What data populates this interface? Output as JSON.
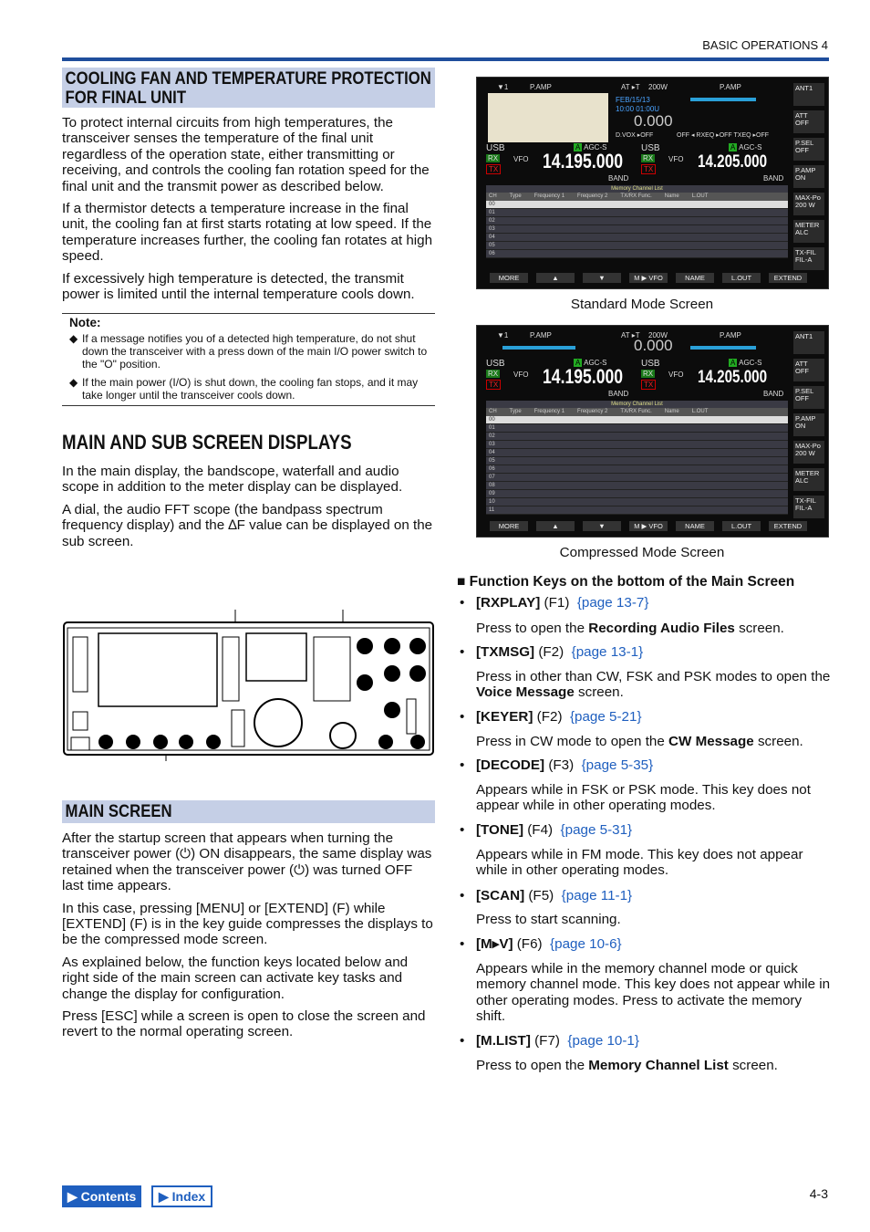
{
  "header": {
    "section": "BASIC OPERATIONS 4",
    "page": "4-3"
  },
  "cooling": {
    "title": "COOLING FAN AND TEMPERATURE PROTECTION FOR FINAL UNIT",
    "p1": "To protect internal circuits from high temperatures, the transceiver senses the temperature of the final unit regardless of the operation state, either transmitting or receiving, and controls the cooling fan rotation speed for the final unit and the transmit power as described below.",
    "p2": "If a thermistor detects a temperature increase in the final unit, the cooling fan at first starts rotating at low speed. If the temperature increases further, the cooling fan rotates at high speed.",
    "p3": "If excessively high temperature is detected, the transmit power is limited until the internal temperature cools down.",
    "note_title": "Note:",
    "note1": "If a message notifies you of a detected high temperature, do not shut down the transceiver with a press down of the main I/O power switch to the \"O\" position.",
    "note2": "If the main power (I/O) is shut down, the cooling fan stops, and it may take longer until the transceiver cools down."
  },
  "displays": {
    "title": "MAIN AND SUB SCREEN DISPLAYS",
    "p1": "In the main display, the bandscope, waterfall and audio scope in addition to the meter display can be displayed.",
    "p2": "A dial, the audio FFT scope (the bandpass spectrum frequency display) and the ∆F value can be displayed on the sub screen."
  },
  "main_screen": {
    "title": "MAIN SCREEN",
    "p1": "After the startup screen that appears when turning the transceiver power (⏻) ON disappears, the same display was retained when the transceiver power (⏻) was turned OFF last time appears.",
    "p2": "In this case, pressing [MENU] or [EXTEND] (F) while [EXTEND] (F) is in the key guide compresses the displays to be the compressed mode screen.",
    "p3": "As explained below, the function keys located below and right side of the main screen can activate key tasks and change the display for configuration.",
    "p4": "Press [ESC] while a screen is open to close the screen and revert to the normal operating screen."
  },
  "screen": {
    "pamp": "P.AMP",
    "at": "AT ▸T",
    "power": "200W",
    "date": "FEB/15/13",
    "time": "10:00 01:00U",
    "delta": "0.000",
    "dvox": "D.VOX ▸OFF",
    "eq": "OFF ◂ RXEQ ▸OFF  TXEQ ▸OFF",
    "mode": "USB",
    "rx": "RX",
    "tx": "TX",
    "vfo": "VFO",
    "agc": "AGC-S",
    "band": "BAND",
    "main_freq": "14.195.000",
    "sub_freq": "14.205.000",
    "list_title": "Memory Channel List",
    "cols": [
      "CH",
      "Type",
      "Frequency 1",
      "Frequency 2",
      "TX/RX Func.",
      "Name",
      "L.OUT"
    ],
    "rows_std": [
      "00",
      "01",
      "02",
      "03",
      "04",
      "05",
      "06"
    ],
    "rows_cmp": [
      "00",
      "01",
      "02",
      "03",
      "04",
      "05",
      "06",
      "07",
      "08",
      "09",
      "10",
      "11"
    ],
    "side": [
      "ANT1",
      "ATT OFF",
      "P.SEL OFF",
      "P.AMP ON",
      "MAX-Po 200 W",
      "METER ALC",
      "TX-FIL FIL-A"
    ],
    "fkeys": [
      "MORE",
      "▲",
      "▼",
      "M ▶ VFO",
      "NAME",
      "L.OUT",
      "EXTEND"
    ],
    "caption_std": "Standard Mode Screen",
    "caption_cmp": "Compressed Mode Screen"
  },
  "fkeys": {
    "title": "Function Keys on the bottom of the Main Screen",
    "items": [
      {
        "key": "[RXPLAY]",
        "f": "(F1)",
        "link": "{page 13-7}",
        "d1": "Press to open the ",
        "db": "Recording Audio Files",
        "d2": " screen."
      },
      {
        "key": "[TXMSG]",
        "f": "(F2)",
        "link": "{page 13-1}",
        "d1": "Press in other than CW, FSK and PSK modes to open the ",
        "db": "Voice Message",
        "d2": " screen."
      },
      {
        "key": "[KEYER]",
        "f": "(F2)",
        "link": "{page 5-21}",
        "d1": "Press in CW mode to open the ",
        "db": "CW Message",
        "d2": " screen."
      },
      {
        "key": "[DECODE]",
        "f": "(F3)",
        "link": "{page 5-35}",
        "d1": "Appears while in FSK or PSK mode. This key does not appear while in other operating modes.",
        "db": "",
        "d2": ""
      },
      {
        "key": "[TONE]",
        "f": "(F4)",
        "link": "{page 5-31}",
        "d1": "Appears while in FM mode. This key does not appear while in other operating modes.",
        "db": "",
        "d2": ""
      },
      {
        "key": "[SCAN]",
        "f": "(F5)",
        "link": "{page 11-1}",
        "d1": "Press to start scanning.",
        "db": "",
        "d2": ""
      },
      {
        "key": "[M▸V]",
        "f": "(F6)",
        "link": "{page 10-6}",
        "d1": "Appears while in the memory channel mode or quick memory channel mode. This key does not appear while in other operating modes. Press to activate the memory shift.",
        "db": "",
        "d2": ""
      },
      {
        "key": "[M.LIST]",
        "f": "(F7)",
        "link": "{page 10-1}",
        "d1": "Press to open the ",
        "db": "Memory Channel List",
        "d2": " screen."
      }
    ]
  },
  "nav": {
    "contents": "Contents",
    "index": "Index"
  }
}
